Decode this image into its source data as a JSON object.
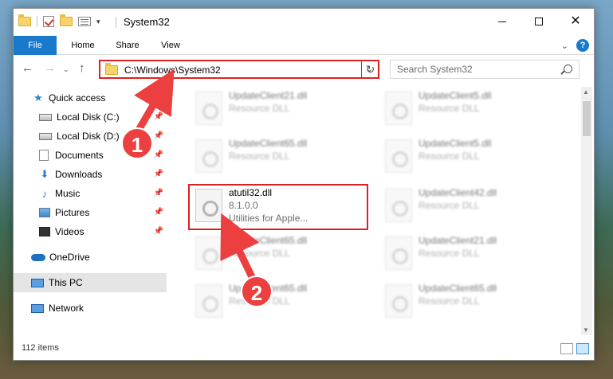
{
  "window": {
    "title": "System32"
  },
  "ribbon": {
    "tabs": [
      "File",
      "Home",
      "Share",
      "View"
    ]
  },
  "address": {
    "path": "C:\\Windows\\System32"
  },
  "search": {
    "placeholder": "Search System32"
  },
  "nav": {
    "items": [
      {
        "label": "Quick access",
        "icon": "star-icon",
        "pinned": false
      },
      {
        "label": "Local Disk (C:)",
        "icon": "disk-icon",
        "pinned": true
      },
      {
        "label": "Local Disk (D:)",
        "icon": "disk-icon",
        "pinned": true
      },
      {
        "label": "Documents",
        "icon": "documents-icon",
        "pinned": true
      },
      {
        "label": "Downloads",
        "icon": "download-icon",
        "pinned": true
      },
      {
        "label": "Music",
        "icon": "music-icon",
        "pinned": true
      },
      {
        "label": "Pictures",
        "icon": "pictures-icon",
        "pinned": true
      },
      {
        "label": "Videos",
        "icon": "videos-icon",
        "pinned": true
      },
      {
        "label": "OneDrive",
        "icon": "cloud-icon",
        "pinned": false
      },
      {
        "label": "This PC",
        "icon": "computer-icon",
        "pinned": false
      },
      {
        "label": "Network",
        "icon": "network-icon",
        "pinned": false
      }
    ]
  },
  "files": [
    {
      "name": "UpdateClient21.dll",
      "type": "Resource DLL"
    },
    {
      "name": "UpdateClient5.dll",
      "type": "Resource DLL"
    },
    {
      "name": "UpdateClient65.dll",
      "type": "Resource DLL"
    },
    {
      "name": "UpdateClient5.dll",
      "type": "Resource DLL"
    },
    {
      "name": "atutil32.dll",
      "version": "8.1.0.0",
      "type": "Utilities for Apple..."
    },
    {
      "name": "UpdateClient42.dll",
      "type": "Resource DLL"
    },
    {
      "name": "UpdateClient65.dll",
      "type": "Resource DLL"
    },
    {
      "name": "UpdateClient21.dll",
      "type": "Resource DLL"
    },
    {
      "name": "UpdateClient65.dll",
      "type": "Resource DLL"
    },
    {
      "name": "UpdateClient65.dll",
      "type": "Resource DLL"
    }
  ],
  "status": {
    "items_count": "112 items"
  },
  "annotations": [
    {
      "number": "1"
    },
    {
      "number": "2"
    }
  ],
  "colors": {
    "accent": "#1979ca",
    "highlight": "#e02020",
    "selection": "#cce8ff"
  }
}
